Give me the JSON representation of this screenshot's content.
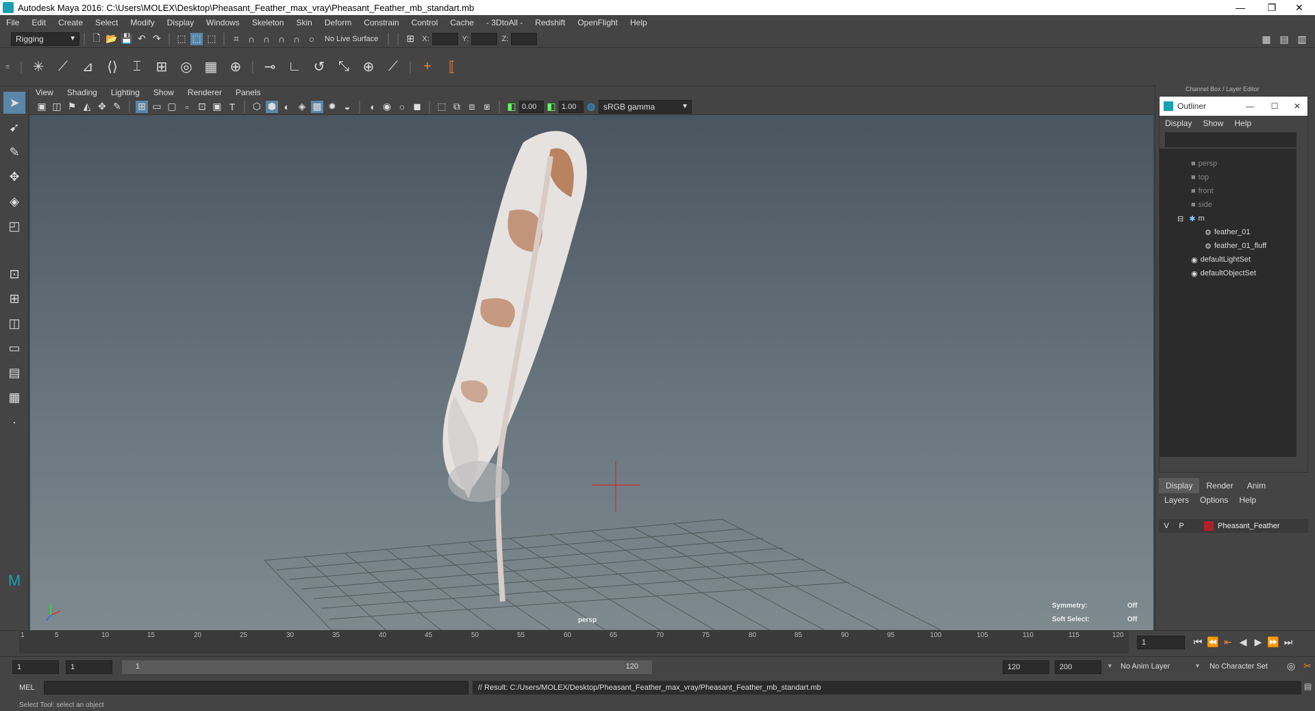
{
  "window": {
    "title": "Autodesk Maya 2016: C:\\Users\\MOLEX\\Desktop\\Pheasant_Feather_max_vray\\Pheasant_Feather_mb_standart.mb",
    "controls": [
      "—",
      "❐",
      "✕"
    ]
  },
  "menubar": [
    "File",
    "Edit",
    "Create",
    "Select",
    "Modify",
    "Display",
    "Windows",
    "Skeleton",
    "Skin",
    "Deform",
    "Constrain",
    "Control",
    "Cache",
    "- 3DtoAll -",
    "Redshift",
    "OpenFlight",
    "Help"
  ],
  "statusline": {
    "menuset": "Rigging",
    "live_surface": "No Live Surface",
    "x_label": "X:",
    "y_label": "Y:",
    "z_label": "Z:"
  },
  "panel": {
    "menu": [
      "View",
      "Shading",
      "Lighting",
      "Show",
      "Renderer",
      "Panels"
    ],
    "exposure": "0.00",
    "gamma": "1.00",
    "color_space": "sRGB gamma"
  },
  "viewport": {
    "camera": "persp",
    "symmetry_label": "Symmetry:",
    "symmetry_value": "Off",
    "soft_select_label": "Soft Select:",
    "soft_select_value": "Off"
  },
  "channelbox": {
    "header": "Channel Box / Layer Editor"
  },
  "outliner": {
    "title": "Outliner",
    "menu": [
      "Display",
      "Show",
      "Help"
    ],
    "items": [
      {
        "label": "persp",
        "dim": true
      },
      {
        "label": "top",
        "dim": true
      },
      {
        "label": "front",
        "dim": true
      },
      {
        "label": "side",
        "dim": true
      },
      {
        "label": "m",
        "dim": false
      },
      {
        "label": "feather_01",
        "dim": false
      },
      {
        "label": "feather_01_fluff",
        "dim": false
      },
      {
        "label": "defaultLightSet",
        "dim": false
      },
      {
        "label": "defaultObjectSet",
        "dim": false
      }
    ]
  },
  "layers": {
    "tabs": [
      "Display",
      "Render",
      "Anim"
    ],
    "menu": [
      "Layers",
      "Options",
      "Help"
    ],
    "rows": [
      {
        "v": "V",
        "p": "P",
        "name": "Pheasant_Feather",
        "color": "#b0202a"
      }
    ]
  },
  "timeline": {
    "ticks": [
      "5",
      "10",
      "15",
      "20",
      "25",
      "30",
      "35",
      "40",
      "45",
      "50",
      "55",
      "60",
      "65",
      "70",
      "75",
      "80",
      "85",
      "90",
      "95",
      "100",
      "105",
      "110",
      "115",
      "120"
    ],
    "first": "1",
    "current_frame": "1"
  },
  "range": {
    "start": "1",
    "start2": "1",
    "slider_start": "1",
    "slider_end": "120",
    "end": "120",
    "end2": "200",
    "anim_layer": "No Anim Layer",
    "character_set": "No Character Set"
  },
  "cmdline": {
    "mode": "MEL",
    "result": "// Result: C:/Users/MOLEX/Desktop/Pheasant_Feather_max_vray/Pheasant_Feather_mb_standart.mb"
  },
  "helpline": "Select Tool: select an object"
}
